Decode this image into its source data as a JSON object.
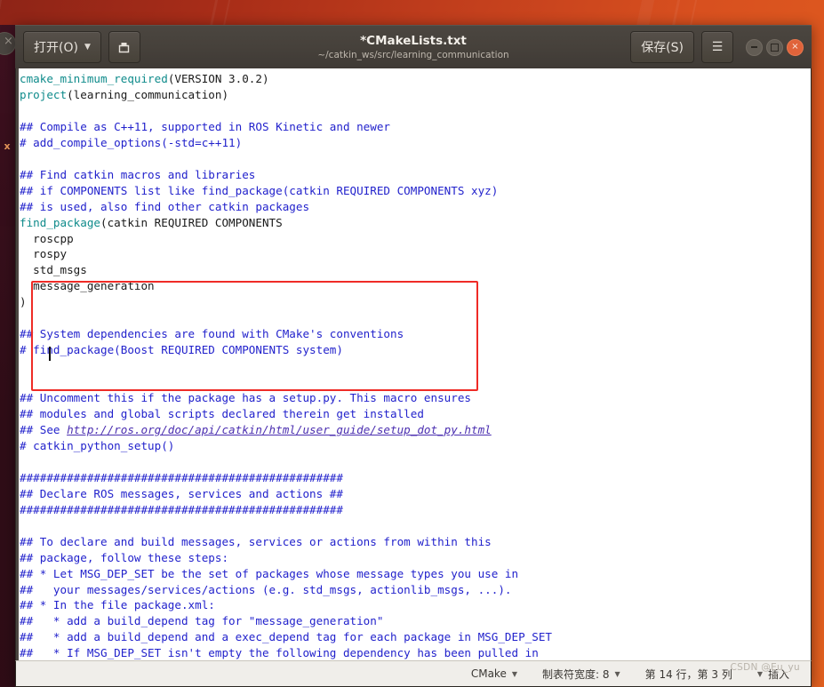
{
  "window": {
    "title": "*CMakeLists.txt",
    "subtitle": "~/catkin_ws/src/learning_communication",
    "open_button": "打开(O)",
    "open_caret": "▼",
    "saveas_icon": "save-as-icon",
    "save_button": "保存(S)",
    "menu_button": "☰",
    "controls": {
      "minimize": "minimize",
      "maximize": "maximize",
      "close": "×"
    }
  },
  "editor": {
    "lines": [
      {
        "t": "cmake_minimum_required",
        "k": "fn"
      },
      {
        "t": "(VERSION 3.0.2)",
        "k": "plain"
      },
      {
        "t": "\n",
        "k": "plain"
      },
      {
        "t": "project",
        "k": "fn"
      },
      {
        "t": "(learning_communication)\n\n",
        "k": "plain"
      },
      {
        "t": "## Compile as C++11, supported in ROS Kinetic and newer\n# add_compile_options(-std=c++11)\n\n## Find catkin macros and libraries\n## if COMPONENTS list like find_package(catkin REQUIRED COMPONENTS xyz)\n## is used, also find other catkin packages\n",
        "k": "cm"
      },
      {
        "t": "find_package",
        "k": "fn"
      },
      {
        "t": "(catkin REQUIRED COMPONENTS\n  roscpp\n  rospy\n  std_msgs\n  message_generation\n)\n\n",
        "k": "plain"
      },
      {
        "t": "## System dependencies are found with CMake's conventions\n# find_package(Boost REQUIRED COMPONENTS system)\n\n\n## Uncomment this if the package has a setup.py. This macro ensures\n## modules and global scripts declared therein get installed\n## See ",
        "k": "cm"
      },
      {
        "t": "http://ros.org/doc/api/catkin/html/user_guide/setup_dot_py.html",
        "k": "url"
      },
      {
        "t": "\n# catkin_python_setup()\n\n################################################\n## Declare ROS messages, services and actions ##\n################################################\n\n## To declare and build messages, services or actions from within this\n## package, follow these steps:\n## * Let MSG_DEP_SET be the set of packages whose message types you use in\n##   your messages/services/actions (e.g. std_msgs, actionlib_msgs, ...).\n## * In the file package.xml:\n##   * add a build_depend tag for \"message_generation\"\n##   * add a build_depend and a exec_depend tag for each package in MSG_DEP_SET\n##   * If MSG_DEP_SET isn't empty the following dependency has been pulled in\n##     but can be declared for certainty nonetheless:",
        "k": "cm"
      }
    ],
    "annotation": {
      "shape": "red-rectangle",
      "highlights": "find_package(catkin REQUIRED COMPONENTS ... )"
    }
  },
  "statusbar": {
    "language": "CMake",
    "language_caret": "▼",
    "tabwidth": "制表符宽度: 8",
    "tabwidth_caret": "▼",
    "position": "第 14 行，第 3 列",
    "insert_mode": "插入",
    "insert_caret": "▼",
    "watermark": "CSDN @Eu_yu"
  },
  "colors": {
    "desktop_orange": "#c4401d",
    "headerbar": "#46413b",
    "annotation_red": "#ef2b26",
    "comment_blue": "#2222cc",
    "function_teal": "#0f8b8b",
    "url_purple": "#4b2fb0",
    "close_button": "#e0633a"
  }
}
